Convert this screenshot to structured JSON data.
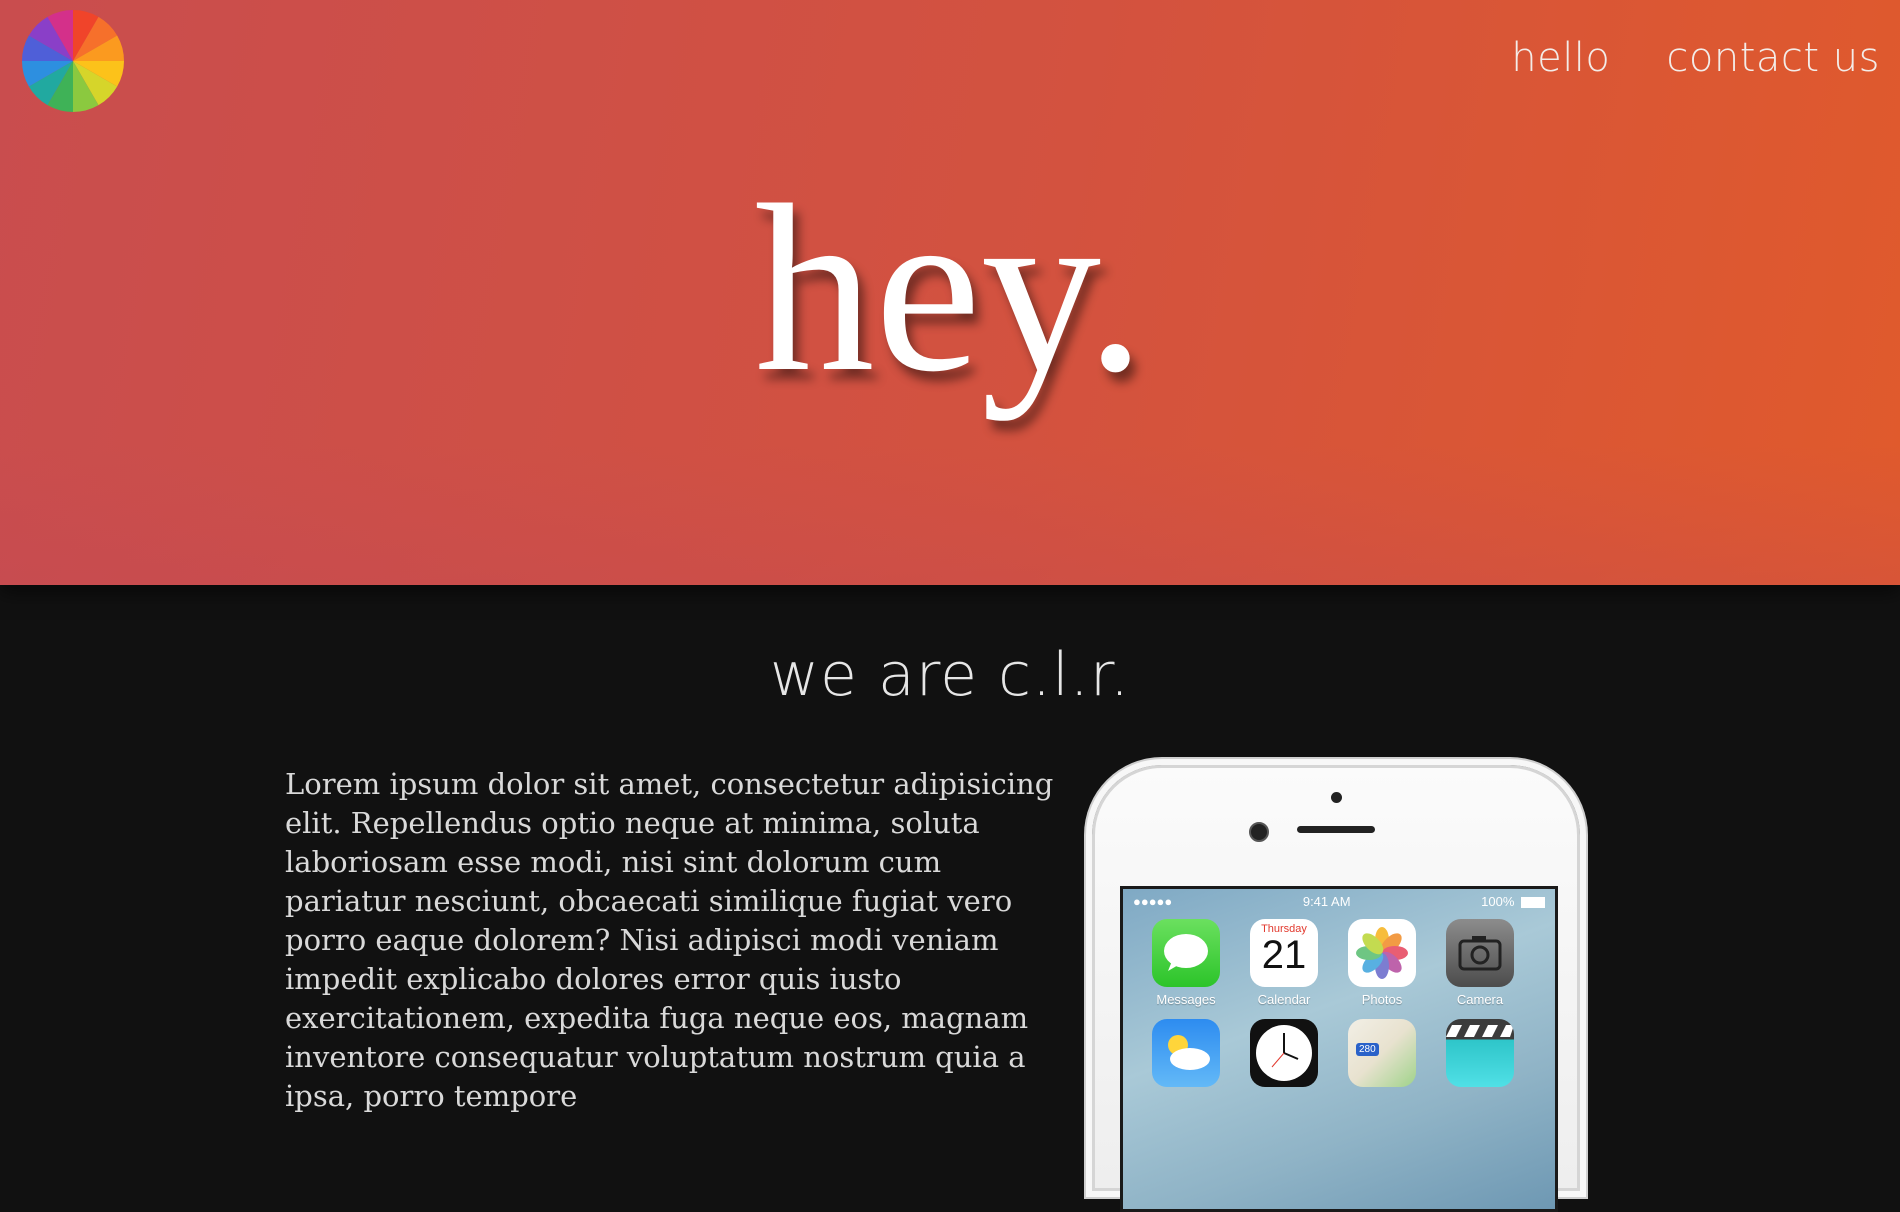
{
  "nav": {
    "items": [
      {
        "label": "hello"
      },
      {
        "label": "contact us"
      }
    ]
  },
  "hero": {
    "title": "hey."
  },
  "about": {
    "title": "we are c.l.r.",
    "body": "Lorem ipsum dolor sit amet, consectetur adipisicing elit. Repellendus optio neque at minima, soluta laboriosam esse modi, nisi sint dolorum cum pariatur nesciunt, obcaecati similique fugiat vero porro eaque dolorem? Nisi adipisci modi veniam impedit explicabo dolores error quis iusto exercitationem, expedita fuga neque eos, magnam inventore consequatur voluptatum nostrum quia a ipsa, porro tempore"
  },
  "phone": {
    "status": {
      "signal": "●●●●● ",
      "time": "9:41 AM",
      "battery": "100%"
    },
    "apps": [
      {
        "name": "Messages",
        "icon": "messages-icon"
      },
      {
        "name": "Calendar",
        "icon": "calendar-icon",
        "day": "Thursday",
        "date": "21"
      },
      {
        "name": "Photos",
        "icon": "photos-icon"
      },
      {
        "name": "Camera",
        "icon": "camera-icon"
      },
      {
        "name": "",
        "icon": "weather-icon"
      },
      {
        "name": "",
        "icon": "clock-icon"
      },
      {
        "name": "",
        "icon": "maps-icon",
        "badge": "280"
      },
      {
        "name": "",
        "icon": "videos-icon"
      }
    ]
  },
  "colors": {
    "hero_gradient_start": "#c94d4e",
    "hero_gradient_end": "#e05a2c",
    "dark_background": "#111111"
  }
}
